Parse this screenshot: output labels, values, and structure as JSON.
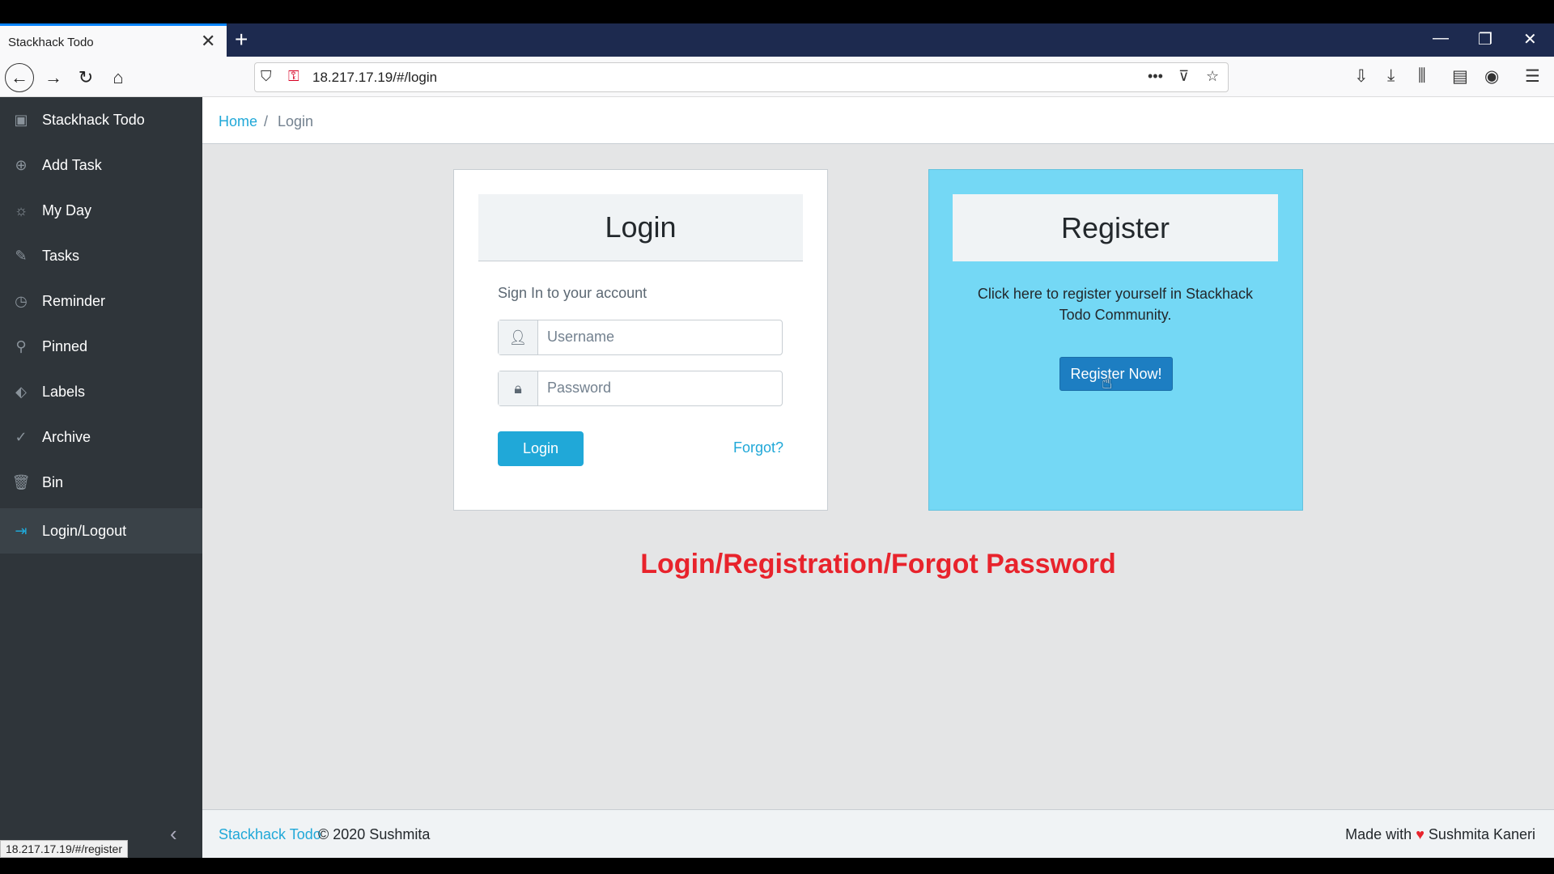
{
  "browser": {
    "tab_title": "Stackhack Todo",
    "tab_close": "✕",
    "new_tab": "+",
    "url": "18.217.17.19/#/login",
    "status_url": "18.217.17.19/#/register",
    "window_controls": [
      "—",
      "❐",
      "✕"
    ]
  },
  "sidebar": {
    "items": [
      {
        "label": "Stackhack Todo",
        "icon": "app-logo-icon",
        "glyph": "▣"
      },
      {
        "label": "Add Task",
        "icon": "plus-circle-icon",
        "glyph": "⊕"
      },
      {
        "label": "My Day",
        "icon": "sun-icon",
        "glyph": "☼"
      },
      {
        "label": "Tasks",
        "icon": "pencil-icon",
        "glyph": "✎"
      },
      {
        "label": "Reminder",
        "icon": "clock-icon",
        "glyph": "◷"
      },
      {
        "label": "Pinned",
        "icon": "pin-icon",
        "glyph": "⚲"
      },
      {
        "label": "Labels",
        "icon": "tag-icon",
        "glyph": "⬖"
      },
      {
        "label": "Archive",
        "icon": "check-circle-icon",
        "glyph": "✓"
      },
      {
        "label": "Bin",
        "icon": "trash-icon",
        "glyph": "🗑"
      },
      {
        "label": "Login/Logout",
        "icon": "login-icon",
        "glyph": "⇥"
      }
    ],
    "collapse": "‹"
  },
  "breadcrumb": {
    "home": "Home",
    "separator": "/",
    "current": "Login"
  },
  "login": {
    "title": "Login",
    "subtitle": "Sign In to your account",
    "username_placeholder": "Username",
    "password_placeholder": "Password",
    "button": "Login",
    "forgot": "Forgot?"
  },
  "register": {
    "title": "Register",
    "text": "Click here to register yourself in Stackhack Todo Community.",
    "button": "Register Now!"
  },
  "caption": "Login/Registration/Forgot Password",
  "footer": {
    "brand": "Stackhack Todo",
    "copyright": "© 2020 Sushmita",
    "made_with": "Made with",
    "author": "Sushmita Kaneri"
  },
  "colors": {
    "accent": "#20a8d8",
    "sidebar": "#2f353a",
    "register_bg": "#74d8f5",
    "caption": "#e8232c"
  }
}
